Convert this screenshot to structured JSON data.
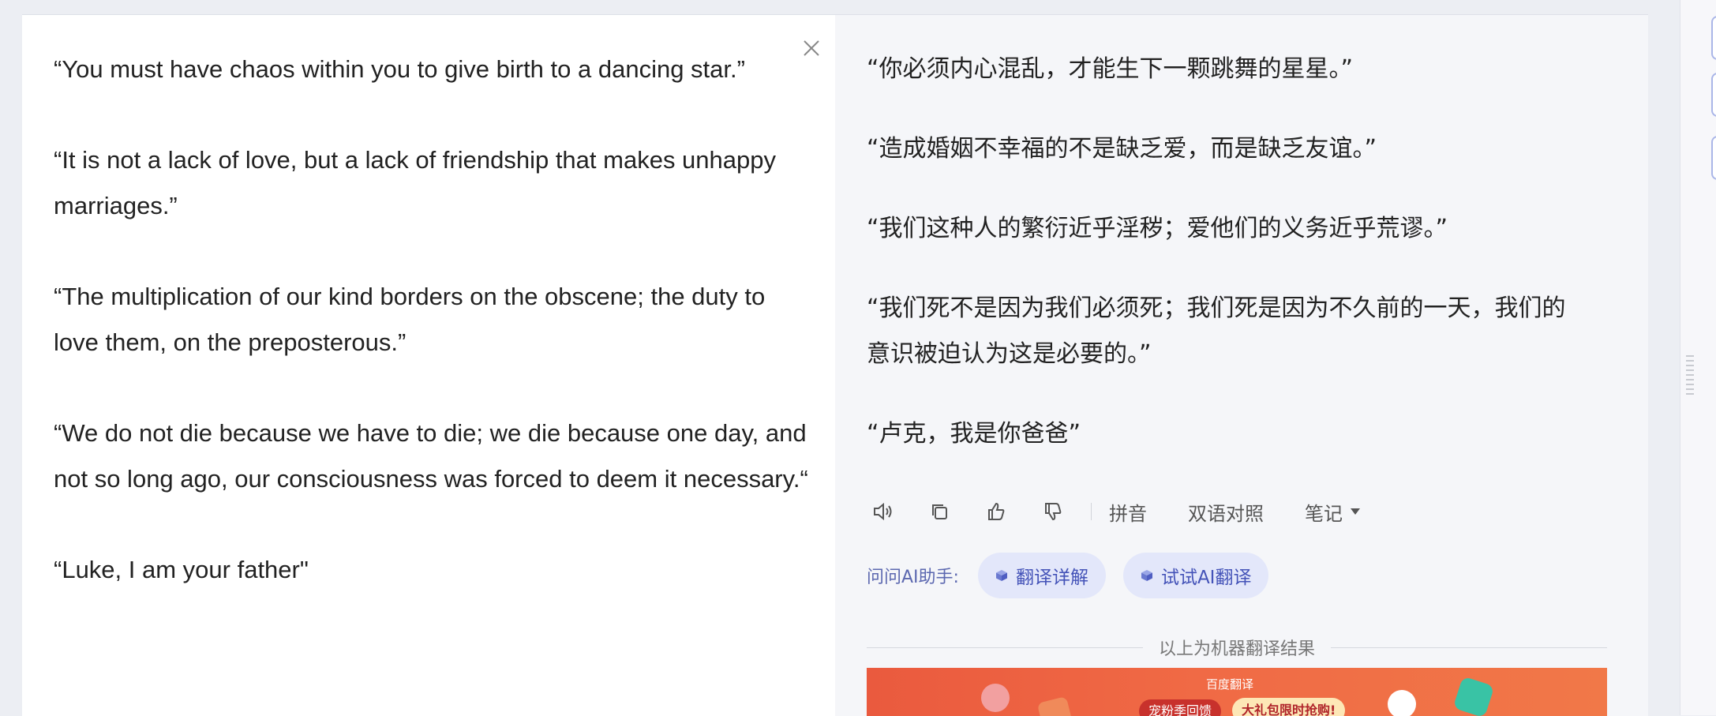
{
  "source": {
    "paragraphs": [
      " “You must have chaos within you to give birth to a dancing star.”",
      " “It is not a lack of love, but a lack of friendship that makes unhappy marriages.”",
      " “The multiplication of our kind borders on the obscene; the duty to love them, on the preposterous.”",
      "“We do not die because we have to die; we die because one day, and not so long ago, our consciousness was forced to deem it necessary.“",
      "“Luke, I am your father\""
    ]
  },
  "translation": {
    "paragraphs": [
      "“你必须内心混乱，才能生下一颗跳舞的星星。”",
      "“造成婚姻不幸福的不是缺乏爱，而是缺乏友谊。”",
      "“我们这种人的繁衍近乎淫秽；爱他们的义务近乎荒谬。”",
      "“我们死不是因为我们必须死；我们死是因为不久前的一天，我们的意识被迫认为这是必要的。”",
      "“卢克，我是你爸爸”"
    ]
  },
  "toolbar": {
    "pinyin": "拼音",
    "bilingual": "双语对照",
    "notes": "笔记"
  },
  "ai_assistant": {
    "label": "问问AI助手:",
    "chip_explain": "翻译详解",
    "chip_try": "试试AI翻译"
  },
  "divider": {
    "label": "以上为机器翻译结果"
  },
  "banner": {
    "brand": "百度翻译",
    "pill_left": "宠粉季回馈",
    "pill_right": "大礼包限时抢购!"
  },
  "colors": {
    "accent": "#4453b8",
    "chip_bg": "#e3e7fa",
    "panel_bg": "#f5f6f9"
  }
}
